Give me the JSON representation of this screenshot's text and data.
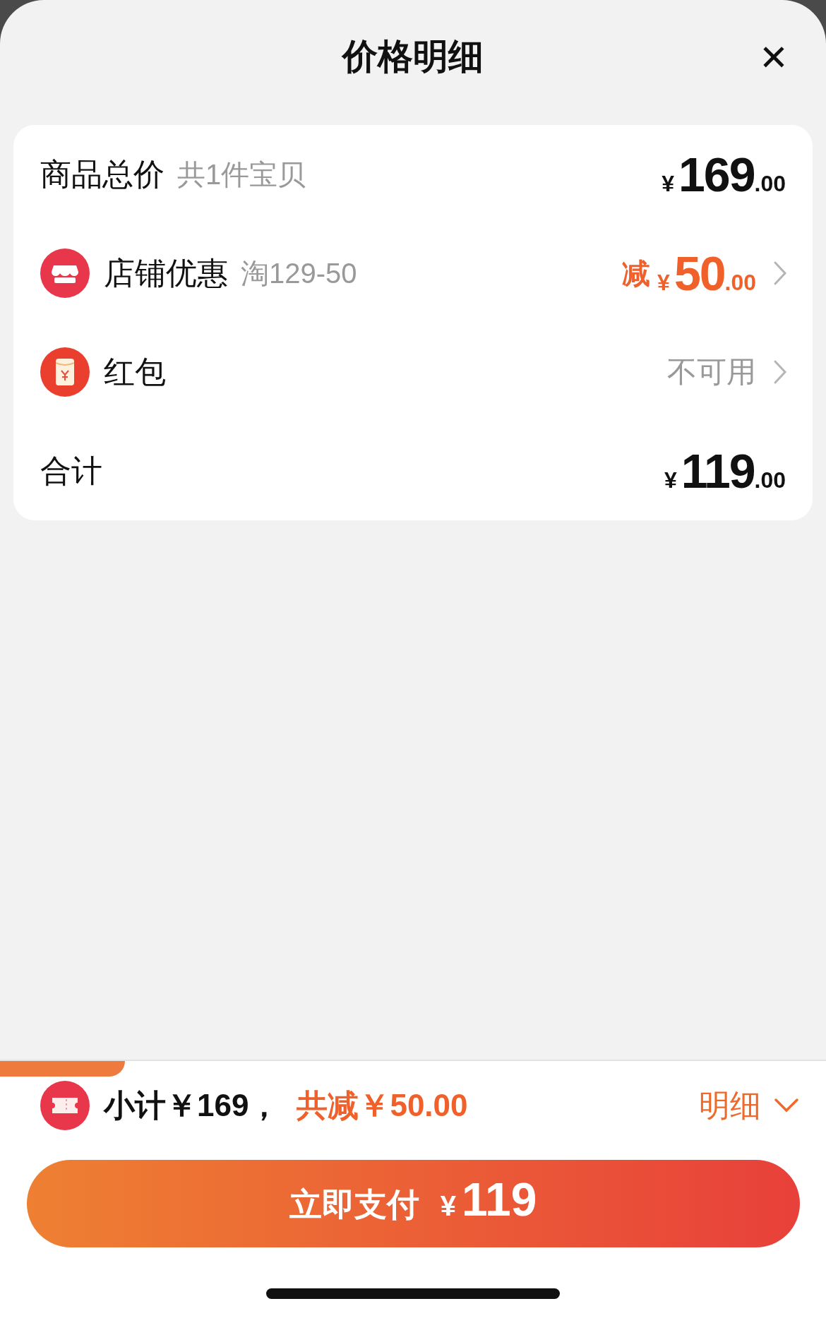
{
  "sheet": {
    "title": "价格明细",
    "close_label": "✕"
  },
  "rows": [
    {
      "kind": "total",
      "label": "商品总价",
      "note": "共1件宝贝",
      "price": {
        "currency": "¥",
        "integer": "169",
        "decimal": ".00"
      }
    },
    {
      "kind": "coupon",
      "label": "店铺优惠",
      "note": "淘129-50",
      "prefix": "减",
      "price": {
        "currency": "¥",
        "integer": "50",
        "decimal": ".00"
      },
      "chevron": true
    },
    {
      "kind": "status",
      "label": "红包",
      "status": "不可用",
      "chevron": true
    },
    {
      "kind": "total",
      "label": "合计",
      "price": {
        "currency": "¥",
        "integer": "119",
        "decimal": ".00"
      }
    }
  ],
  "footer": {
    "subtotal": "小计￥169，",
    "discount": "共减￥50.00",
    "detail_link": "明细",
    "expanded": false,
    "pay_button": {
      "label": "立即支付",
      "currency": "¥",
      "amount": "119"
    }
  }
}
